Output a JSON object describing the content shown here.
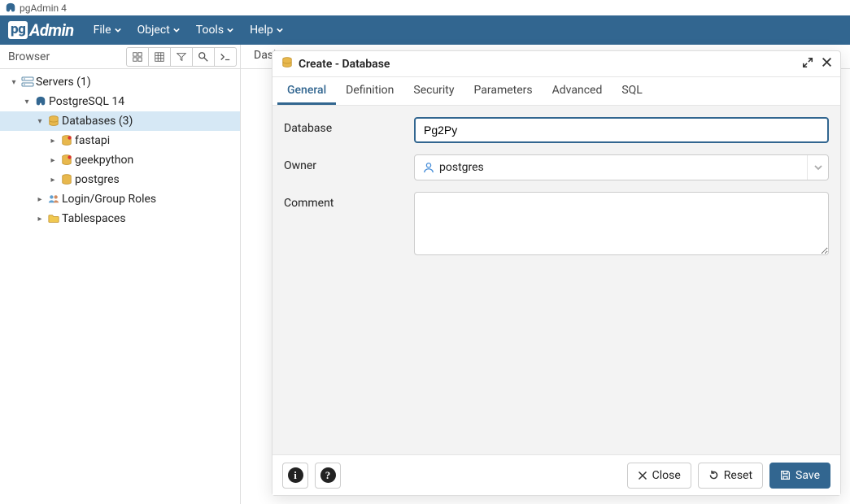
{
  "window_title": "pgAdmin 4",
  "logo": {
    "pg": "pg",
    "admin": "Admin"
  },
  "menu": [
    "File",
    "Object",
    "Tools",
    "Help"
  ],
  "browser": {
    "title": "Browser",
    "tree": {
      "servers": "Servers (1)",
      "server": "PostgreSQL 14",
      "databases": "Databases (3)",
      "db1": "fastapi",
      "db2": "geekpython",
      "db3": "postgres",
      "roles": "Login/Group Roles",
      "tablespaces": "Tablespaces"
    }
  },
  "right_tab": "Dash",
  "dialog": {
    "title": "Create - Database",
    "tabs": [
      "General",
      "Definition",
      "Security",
      "Parameters",
      "Advanced",
      "SQL"
    ],
    "labels": {
      "database": "Database",
      "owner": "Owner",
      "comment": "Comment"
    },
    "values": {
      "database": "Pg2Py",
      "owner": "postgres",
      "comment": ""
    },
    "buttons": {
      "close": "Close",
      "reset": "Reset",
      "save": "Save"
    }
  }
}
